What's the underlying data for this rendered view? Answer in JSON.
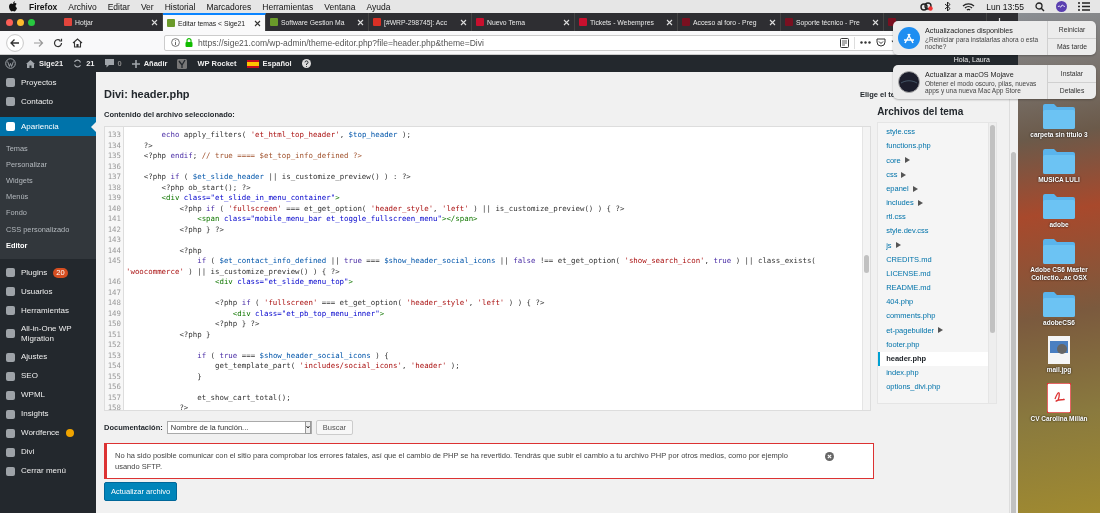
{
  "menubar": {
    "app": "Firefox",
    "menus": [
      "Archivo",
      "Editar",
      "Ver",
      "Historial",
      "Marcadores",
      "Herramientas",
      "Ventana",
      "Ayuda"
    ],
    "clock": "Lun 13:55"
  },
  "browser_tabs": [
    {
      "title": "Hotjar",
      "selected": false,
      "color": "#e2453c"
    },
    {
      "title": "Editar temas < Sige21",
      "selected": true,
      "color": "#6a9a2a"
    },
    {
      "title": "Software Gestion Ma",
      "selected": false,
      "color": "#6a9a2a"
    },
    {
      "title": "[#WRP-298745]: Acc",
      "selected": false,
      "color": "#d93025"
    },
    {
      "title": "Nuevo Tema",
      "selected": false,
      "color": "#c8102e"
    },
    {
      "title": "Tickets - Webempres",
      "selected": false,
      "color": "#c8102e"
    },
    {
      "title": "Acceso al foro - Preg",
      "selected": false,
      "color": "#7a1020"
    },
    {
      "title": "Soporte técnico - Pre",
      "selected": false,
      "color": "#7a1020"
    },
    {
      "selected": false,
      "color": "#7a1020"
    }
  ],
  "address_bar": {
    "url": "https://sige21.com/wp-admin/theme-editor.php?file=header.php&theme=Divi"
  },
  "admin_bar": {
    "site": "Sige21",
    "updates": "21",
    "comments": "0",
    "new": "Añadir",
    "plugin": "WP Rocket",
    "language": "Español",
    "greeting": "Hola, Laura"
  },
  "sidebar": {
    "items": [
      {
        "label": "Proyectos",
        "selected": false,
        "warning": false
      },
      {
        "label": "Contacto",
        "selected": false,
        "warning": false
      },
      {
        "label": "Apariencia",
        "selected": true,
        "warning": false,
        "children": [
          {
            "label": "Temas",
            "selected": false
          },
          {
            "label": "Personalizar",
            "selected": false
          },
          {
            "label": "Widgets",
            "selected": false
          },
          {
            "label": "Menús",
            "selected": false
          },
          {
            "label": "Fondo",
            "selected": false
          },
          {
            "label": "CSS personalizado",
            "selected": false
          },
          {
            "label": "Editor",
            "selected": true
          }
        ]
      },
      {
        "label": "Plugins",
        "selected": false,
        "warning": false,
        "badge": "20"
      },
      {
        "label": "Usuarios",
        "selected": false,
        "warning": false
      },
      {
        "label": "Herramientas",
        "selected": false,
        "warning": false
      },
      {
        "label": "All-in-One WP Migration",
        "selected": false,
        "warning": false
      },
      {
        "label": "Ajustes",
        "selected": false,
        "warning": false
      },
      {
        "label": "SEO",
        "selected": false,
        "warning": false
      },
      {
        "label": "WPML",
        "selected": false,
        "warning": false
      },
      {
        "label": "Insights",
        "selected": false,
        "warning": false
      },
      {
        "label": "Wordfence",
        "selected": false,
        "warning": true
      },
      {
        "label": "Divi",
        "selected": false,
        "warning": false
      },
      {
        "label": "Cerrar menú",
        "selected": false,
        "warning": false
      }
    ]
  },
  "page": {
    "title": "Divi: header.php",
    "theme_picker_label": "Elige el te",
    "content_label": "Contenido del archivo seleccionado:"
  },
  "editor": {
    "lines": [
      {
        "number": "133",
        "tokens": [
          {
            "kind": "keyword",
            "text": "        echo"
          },
          {
            "kind": "plain",
            "text": " apply_filters( "
          },
          {
            "kind": "string",
            "text": "'et_html_top_header'"
          },
          {
            "kind": "plain",
            "text": ", "
          },
          {
            "kind": "variable",
            "text": "$top_header"
          },
          {
            "kind": "plain",
            "text": " );"
          }
        ]
      },
      {
        "number": "134",
        "tokens": [
          {
            "kind": "plain",
            "text": "    ?>"
          }
        ]
      },
      {
        "number": "135",
        "tokens": [
          {
            "kind": "plain",
            "text": "    <?php "
          },
          {
            "kind": "keyword",
            "text": "endif"
          },
          {
            "kind": "plain",
            "text": "; "
          },
          {
            "kind": "comment",
            "text": "// true ==== $et_top_info_defined ?>"
          }
        ]
      },
      {
        "number": "136"
      },
      {
        "number": "137",
        "tokens": [
          {
            "kind": "plain",
            "text": "    <?php "
          },
          {
            "kind": "keyword",
            "text": "if"
          },
          {
            "kind": "plain",
            "text": " ( "
          },
          {
            "kind": "variable",
            "text": "$et_slide_header"
          },
          {
            "kind": "plain",
            "text": " || is_customize_preview() ) : ?>"
          }
        ]
      },
      {
        "number": "138",
        "tokens": [
          {
            "kind": "plain",
            "text": "        <?php ob_start(); ?>"
          }
        ]
      },
      {
        "number": "139",
        "tokens": [
          {
            "kind": "tag",
            "text": "        <div"
          },
          {
            "kind": "attr",
            "text": " class=\"et_slide_in_menu_container\""
          },
          {
            "kind": "tag",
            "text": ">"
          }
        ]
      },
      {
        "number": "140",
        "tokens": [
          {
            "kind": "plain",
            "text": "            <?php "
          },
          {
            "kind": "keyword",
            "text": "if"
          },
          {
            "kind": "plain",
            "text": " ( "
          },
          {
            "kind": "string",
            "text": "'fullscreen'"
          },
          {
            "kind": "plain",
            "text": " === et_get_option( "
          },
          {
            "kind": "string",
            "text": "'header_style'"
          },
          {
            "kind": "plain",
            "text": ", "
          },
          {
            "kind": "string",
            "text": "'left'"
          },
          {
            "kind": "plain",
            "text": " ) || is_customize_preview() ) { ?>"
          }
        ]
      },
      {
        "number": "141",
        "tokens": [
          {
            "kind": "tag",
            "text": "                <span"
          },
          {
            "kind": "attr",
            "text": " class=\"mobile_menu_bar et_toggle_fullscreen_menu\""
          },
          {
            "kind": "tag",
            "text": "></span>"
          }
        ]
      },
      {
        "number": "142",
        "tokens": [
          {
            "kind": "plain",
            "text": "            <?php } ?>"
          }
        ]
      },
      {
        "number": "143"
      },
      {
        "number": "144",
        "tokens": [
          {
            "kind": "plain",
            "text": "            <?php"
          }
        ]
      },
      {
        "number": "145",
        "tokens": [
          {
            "kind": "keyword",
            "text": "                if"
          },
          {
            "kind": "plain",
            "text": " ( "
          },
          {
            "kind": "variable",
            "text": "$et_contact_info_defined"
          },
          {
            "kind": "plain",
            "text": " || "
          },
          {
            "kind": "keyword",
            "text": "true"
          },
          {
            "kind": "plain",
            "text": " === "
          },
          {
            "kind": "variable",
            "text": "$show_header_social_icons"
          },
          {
            "kind": "plain",
            "text": " || "
          },
          {
            "kind": "keyword",
            "text": "false"
          },
          {
            "kind": "plain",
            "text": " !== et_get_option( "
          },
          {
            "kind": "string",
            "text": "'show_search_icon'"
          },
          {
            "kind": "plain",
            "text": ", "
          },
          {
            "kind": "keyword",
            "text": "true"
          },
          {
            "kind": "plain",
            "text": " ) || class_exists( "
          },
          {
            "kind": "string",
            "text": "'woocommerce'"
          },
          {
            "kind": "plain",
            "text": " ) || is_customize_preview() ) { ?>"
          }
        ]
      },
      {
        "number": "146",
        "tokens": [
          {
            "kind": "tag",
            "text": "                    <div"
          },
          {
            "kind": "attr",
            "text": " class=\"et_slide_menu_top\""
          },
          {
            "kind": "tag",
            "text": ">"
          }
        ]
      },
      {
        "number": "147"
      },
      {
        "number": "148",
        "tokens": [
          {
            "kind": "plain",
            "text": "                    <?php "
          },
          {
            "kind": "keyword",
            "text": "if"
          },
          {
            "kind": "plain",
            "text": " ( "
          },
          {
            "kind": "string",
            "text": "'fullscreen'"
          },
          {
            "kind": "plain",
            "text": " === et_get_option( "
          },
          {
            "kind": "string",
            "text": "'header_style'"
          },
          {
            "kind": "plain",
            "text": ", "
          },
          {
            "kind": "string",
            "text": "'left'"
          },
          {
            "kind": "plain",
            "text": " ) ) { ?>"
          }
        ]
      },
      {
        "number": "149",
        "tokens": [
          {
            "kind": "tag",
            "text": "                        <div"
          },
          {
            "kind": "attr",
            "text": " class=\"et_pb_top_menu_inner\""
          },
          {
            "kind": "tag",
            "text": ">"
          }
        ]
      },
      {
        "number": "150",
        "tokens": [
          {
            "kind": "plain",
            "text": "                    <?php } ?>"
          }
        ]
      },
      {
        "number": "151",
        "tokens": [
          {
            "kind": "plain",
            "text": "            <?php }"
          }
        ]
      },
      {
        "number": "152"
      },
      {
        "number": "153",
        "tokens": [
          {
            "kind": "keyword",
            "text": "                if"
          },
          {
            "kind": "plain",
            "text": " ( "
          },
          {
            "kind": "keyword",
            "text": "true"
          },
          {
            "kind": "plain",
            "text": " === "
          },
          {
            "kind": "variable",
            "text": "$show_header_social_icons"
          },
          {
            "kind": "plain",
            "text": " ) {"
          }
        ]
      },
      {
        "number": "154",
        "tokens": [
          {
            "kind": "plain",
            "text": "                    get_template_part( "
          },
          {
            "kind": "string",
            "text": "'includes/social_icons'"
          },
          {
            "kind": "plain",
            "text": ", "
          },
          {
            "kind": "string",
            "text": "'header'"
          },
          {
            "kind": "plain",
            "text": " );"
          }
        ]
      },
      {
        "number": "155",
        "tokens": [
          {
            "kind": "plain",
            "text": "                }"
          }
        ]
      },
      {
        "number": "156"
      },
      {
        "number": "157",
        "tokens": [
          {
            "kind": "plain",
            "text": "                et_show_cart_total();"
          }
        ]
      },
      {
        "number": "158",
        "tokens": [
          {
            "kind": "plain",
            "text": "            ?>"
          }
        ]
      }
    ]
  },
  "theme_files": {
    "title": "Archivos del tema",
    "items": [
      {
        "name": "style.css",
        "kind": "file",
        "selected": false
      },
      {
        "name": "functions.php",
        "kind": "file",
        "selected": false
      },
      {
        "name": "core",
        "kind": "folder",
        "selected": false
      },
      {
        "name": "css",
        "kind": "folder",
        "selected": false
      },
      {
        "name": "epanel",
        "kind": "folder",
        "selected": false
      },
      {
        "name": "includes",
        "kind": "folder",
        "selected": false
      },
      {
        "name": "rtl.css",
        "kind": "file",
        "selected": false
      },
      {
        "name": "style.dev.css",
        "kind": "file",
        "selected": false
      },
      {
        "name": "js",
        "kind": "folder",
        "selected": false
      },
      {
        "name": "CREDITS.md",
        "kind": "file",
        "selected": false
      },
      {
        "name": "LICENSE.md",
        "kind": "file",
        "selected": false
      },
      {
        "name": "README.md",
        "kind": "file",
        "selected": false
      },
      {
        "name": "404.php",
        "kind": "file",
        "selected": false
      },
      {
        "name": "comments.php",
        "kind": "file",
        "selected": false
      },
      {
        "name": "et-pagebuilder",
        "kind": "folder",
        "selected": false
      },
      {
        "name": "footer.php",
        "kind": "file",
        "selected": false
      },
      {
        "name": "header.php",
        "kind": "file",
        "selected": true
      },
      {
        "name": "index.php",
        "kind": "file",
        "selected": false
      },
      {
        "name": "options_divi.php",
        "kind": "file",
        "selected": false
      }
    ]
  },
  "documentation": {
    "label": "Documentación:",
    "value": "Nombre de la función...",
    "button": "Buscar"
  },
  "notice": {
    "text": "No ha sido posible comunicar con el sitio para comprobar los errores fatales, así que el cambio de PHP se ha revertido. Tendrás que subir el cambio a tu archivo PHP por otros medios, como por ejemplo usando SFTP.",
    "dismissible": true
  },
  "submit_button": "Actualizar archivo",
  "notifications": [
    {
      "kind": "app-store",
      "title": "Actualizaciones disponibles",
      "body": "¿Reiniciar para instalarlas ahora o esta noche?",
      "actions": [
        "Reiniciar",
        "Más tarde"
      ]
    },
    {
      "kind": "mojave",
      "title": "Actualizar a macOS Mojave",
      "body": "Obtener el modo oscuro, pilas, nuevas apps y una nueva Mac App Store",
      "actions": [
        "Instalar",
        "Detalles"
      ]
    }
  ],
  "desktop": {
    "items": [
      {
        "label": "carpeta sin título 3",
        "kind": "folder"
      },
      {
        "label": "MUSICA LULI",
        "kind": "folder"
      },
      {
        "label": "adobe",
        "kind": "folder"
      },
      {
        "label": "Adobe CS6 Master Collectio...ac OSX",
        "kind": "folder"
      },
      {
        "label": "adobeCS6",
        "kind": "folder"
      },
      {
        "label": "mail.jpg",
        "kind": "jpeg"
      },
      {
        "label": "CV Carolina Millán",
        "kind": "pdf"
      }
    ]
  }
}
